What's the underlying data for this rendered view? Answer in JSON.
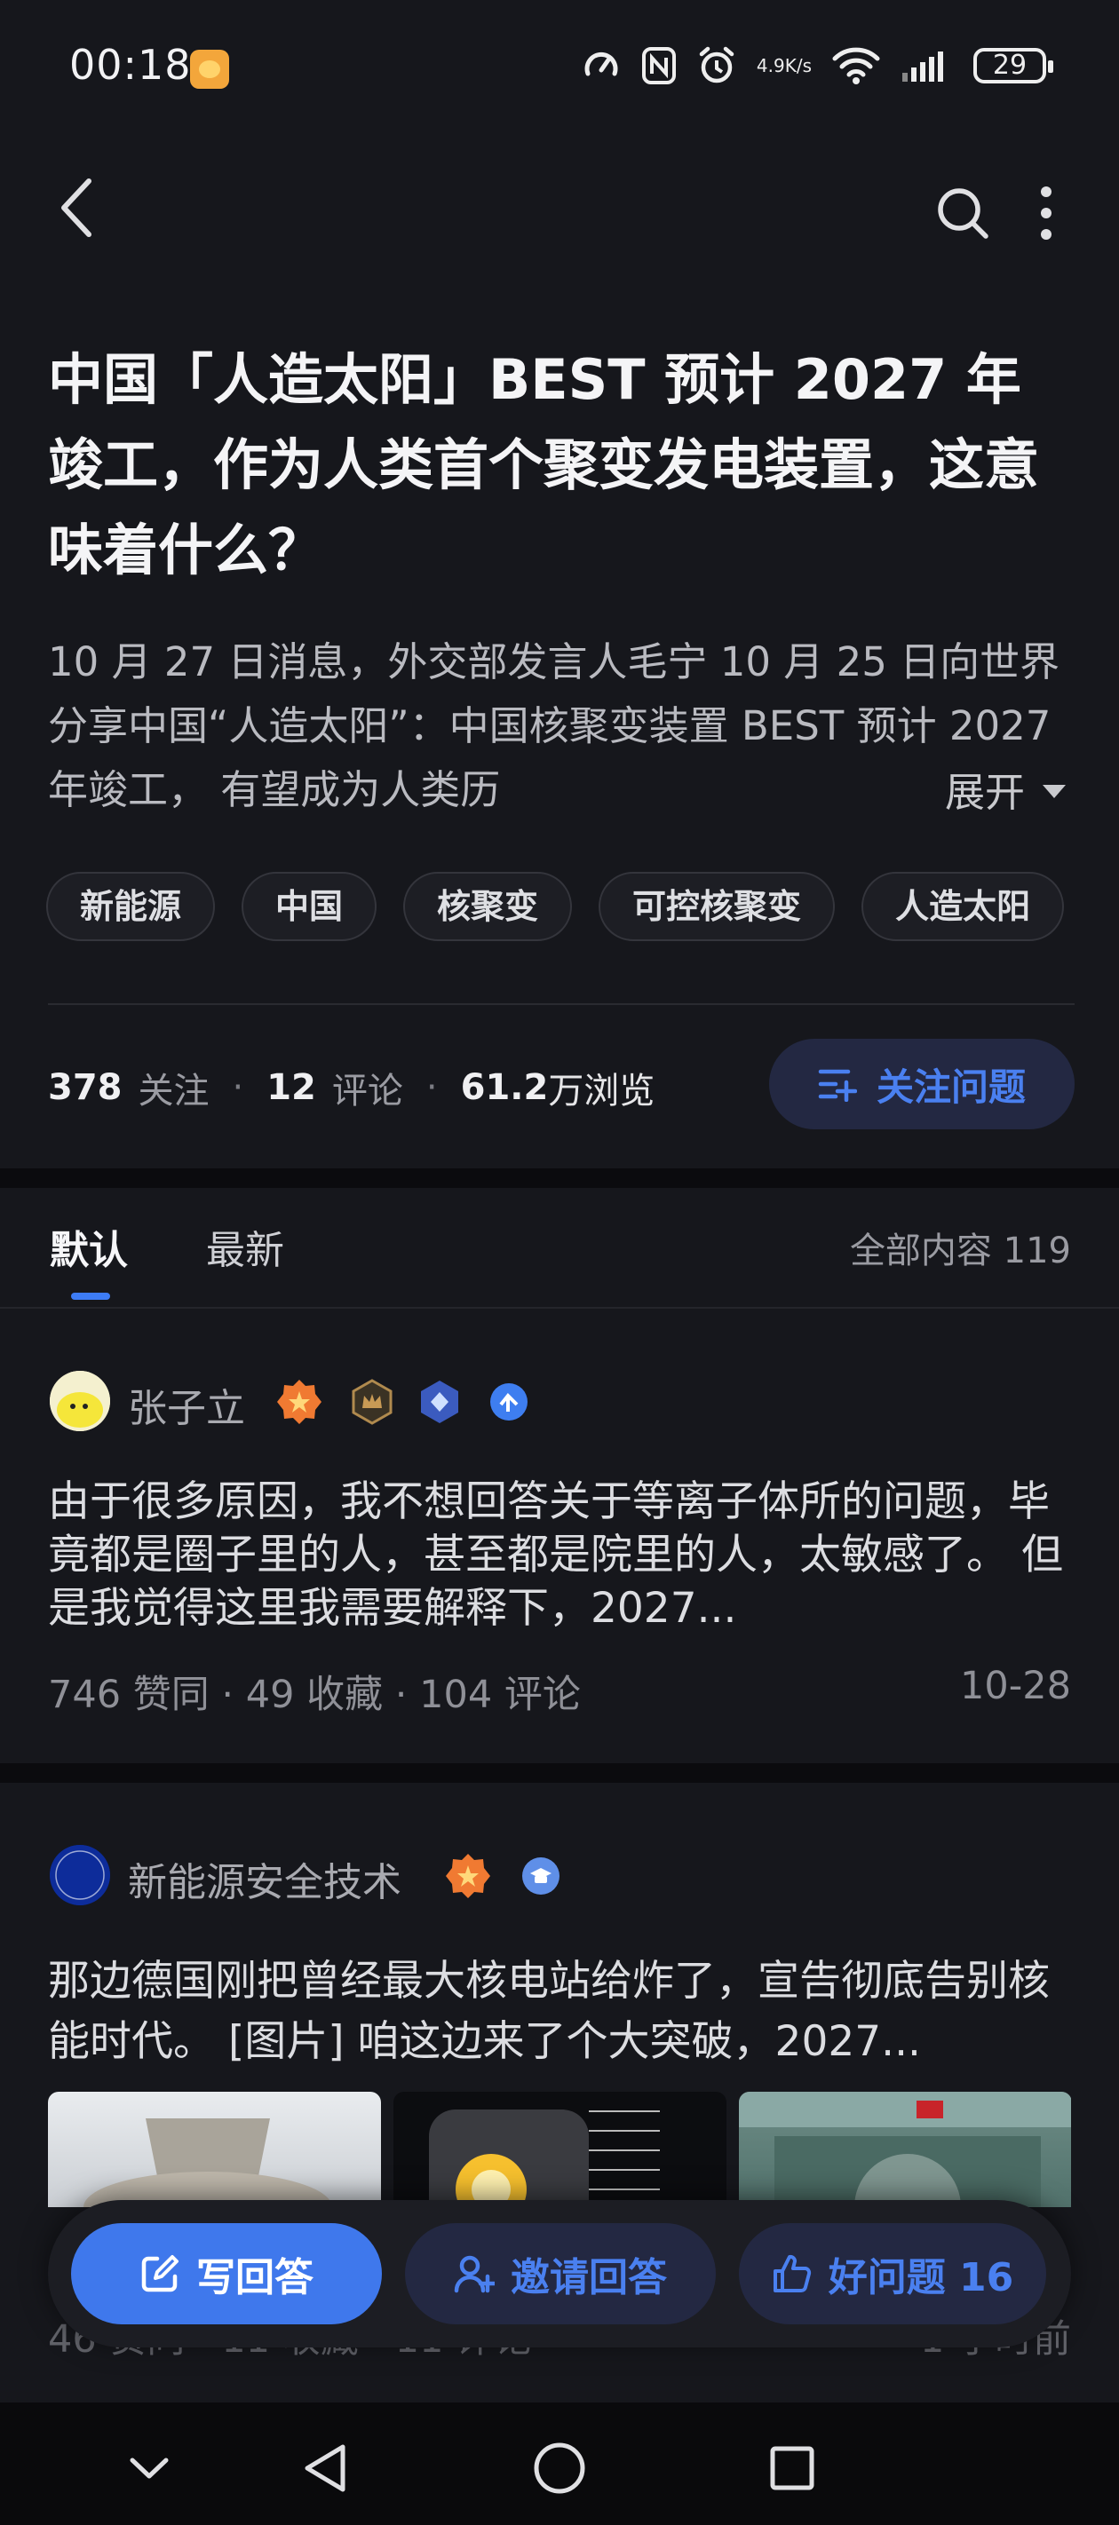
{
  "status_bar": {
    "time": "00:18",
    "net_speed_value": "4.9",
    "net_speed_unit": "K/s",
    "battery": "29"
  },
  "question": {
    "title": "中国「人造太阳」BEST 预计 2027 年竣工，作为人类首个聚变发电装置，这意味着什么？",
    "excerpt": "10 月 27 日消息，外交部发言人毛宁 10 月 25 日向世界分享中国“人造太阳”：中国核聚变装置 BEST 预计 2027 年竣工， 有望成为人类历",
    "expand_label": "展开",
    "tags": [
      "新能源",
      "中国",
      "核聚变",
      "可控核聚变",
      "人造太阳"
    ],
    "stats": {
      "followers": "378",
      "followers_label": "关注",
      "comments": "12",
      "comments_label": "评论",
      "views": "61.2",
      "views_label": "万浏览"
    },
    "follow_button": "关注问题"
  },
  "tabs": {
    "default": "默认",
    "latest": "最新",
    "all_content": "全部内容 119"
  },
  "answers": [
    {
      "author": "张子立",
      "text": "由于很多原因，我不想回答关于等离子体所的问题，毕竟都是圈子里的人，甚至都是院里的人，太敏感了。 但是我觉得这里我需要解释下，2027...",
      "meta": "746 赞同 · 49 收藏 · 104 评论",
      "date": "10-28"
    },
    {
      "author": "新能源安全技术",
      "avatar_text": "新能源安全技术",
      "text": "那边德国刚把曾经最大核电站给炸了，宣告彻底告别核能时代。 [图片] 咱这边来了个大突破，2027...",
      "meta": "46 赞同 · 11 收藏 · 11 评论",
      "date": "1 小时前"
    }
  ],
  "bottom_actions": {
    "write": "写回答",
    "invite": "邀请回答",
    "good_question": "好问题 16"
  },
  "colors": {
    "background": "#16171c",
    "accent": "#3f78ec",
    "accent_text": "#4a80f0"
  }
}
